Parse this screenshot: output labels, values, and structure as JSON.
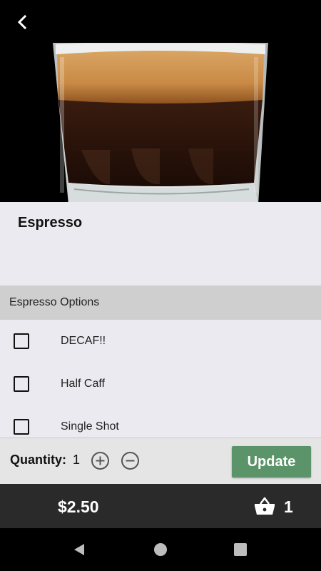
{
  "product": {
    "name": "Espresso",
    "image_alt": "espresso shot in glass"
  },
  "options": {
    "header": "Espresso Options",
    "items": [
      {
        "label": "DECAF!!",
        "checked": false
      },
      {
        "label": "Half Caff",
        "checked": false
      },
      {
        "label": "Single Shot",
        "checked": false
      }
    ]
  },
  "quantity": {
    "label": "Quantity:",
    "value": "1",
    "update_label": "Update",
    "accent_color": "#5b9469"
  },
  "cart": {
    "price": "$2.50",
    "count": "1",
    "icon": "basket-icon"
  },
  "system_nav": {
    "back_icon": "triangle-back-icon",
    "home_icon": "circle-home-icon",
    "recent_icon": "square-recents-icon"
  }
}
